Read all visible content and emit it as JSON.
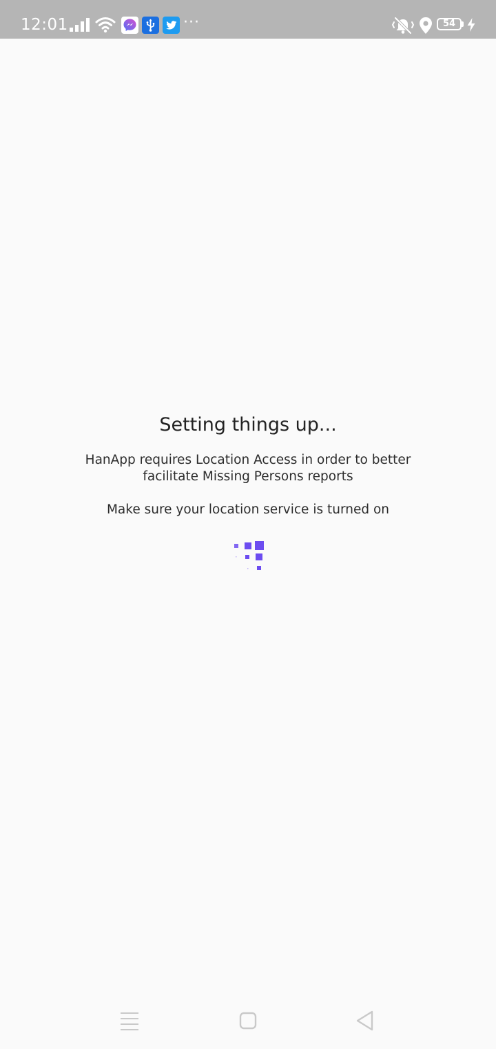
{
  "status_bar": {
    "time": "12:01",
    "battery_level": "54",
    "icons": [
      "signal-icon",
      "wifi-icon",
      "messenger-icon",
      "usb-icon",
      "twitter-icon",
      "more-dots-icon",
      "vibrate-icon",
      "location-icon",
      "battery-icon",
      "charging-icon"
    ],
    "more_indicator": "···"
  },
  "main": {
    "title": "Setting things up...",
    "message": "HanApp requires Location Access in order to better facilitate Missing Persons reports",
    "hint": "Make sure your location service is turned on",
    "spinner_icon": "loading-squares-icon",
    "accent_color": "#6c4cf0"
  },
  "nav_bar": {
    "buttons": [
      "menu-icon",
      "home-icon",
      "back-icon"
    ]
  }
}
